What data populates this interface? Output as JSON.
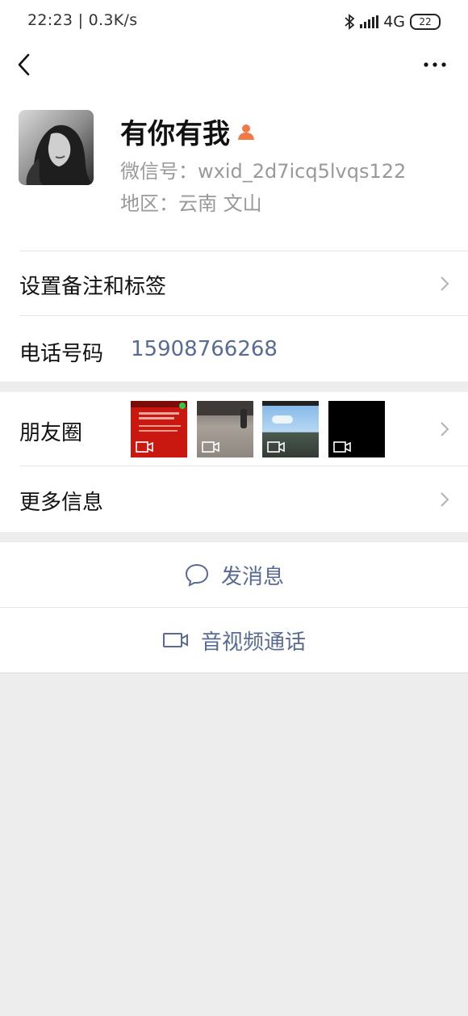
{
  "status_bar": {
    "time_speed": "22:23 | 0.3K/s",
    "network": "4G",
    "battery": "22"
  },
  "profile": {
    "name": "有你有我",
    "wechat_id": "微信号：wxid_2d7icq5lvqs122",
    "region": "地区：云南  文山"
  },
  "rows": {
    "remark_tags": "设置备注和标签",
    "phone_label": "电话号码",
    "phone_value": "15908766268",
    "moments_label": "朋友圈",
    "more_info": "更多信息"
  },
  "actions": {
    "send_message": "发消息",
    "video_call": "音视频通话"
  },
  "colors": {
    "link": "#576b95",
    "background": "#ededed",
    "gender_badge": "#f07a47"
  }
}
